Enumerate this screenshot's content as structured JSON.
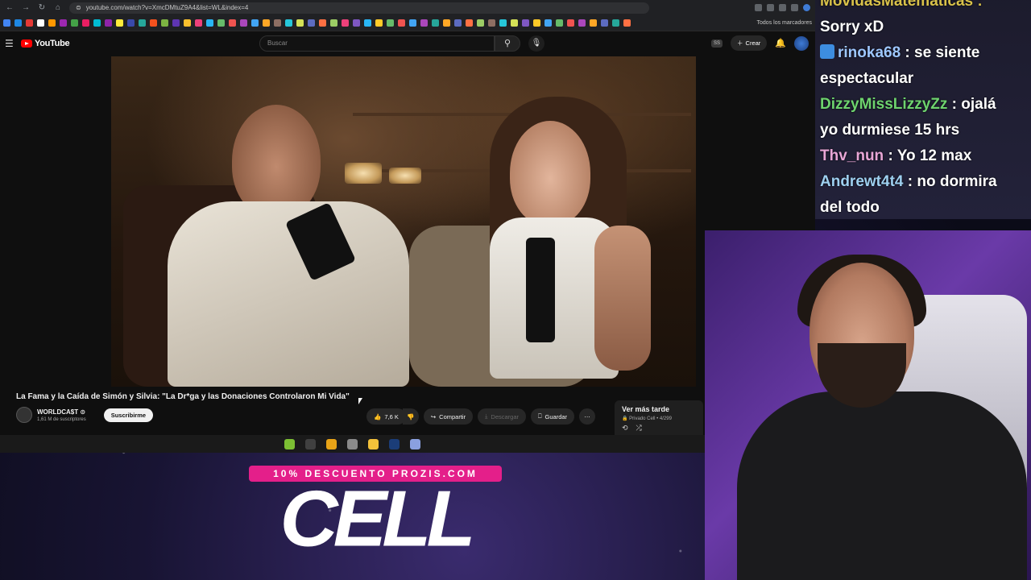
{
  "browser": {
    "url": "youtube.com/watch?v=XmcDMtuZ9A4&list=WL&index=4",
    "bookmarks_folder": "Todos los marcadores",
    "bookmark_colors": [
      "#4285f4",
      "#1e88e5",
      "#e53935",
      "#fff",
      "#ff9800",
      "#9c27b0",
      "#43a047",
      "#e91e63",
      "#00bcd4",
      "#8e24aa",
      "#ffeb3b",
      "#3949ab",
      "#26a69a",
      "#f4511e",
      "#7cb342",
      "#5e35b1",
      "#fbc02d",
      "#ec407a",
      "#29b6f6",
      "#66bb6a",
      "#ef5350",
      "#ab47bc",
      "#42a5f5",
      "#ffa726",
      "#8d6e63",
      "#26c6da",
      "#d4e157",
      "#5c6bc0",
      "#ff7043",
      "#9ccc65",
      "#ec407a",
      "#7e57c2",
      "#29b6f6",
      "#ffca28",
      "#66bb6a",
      "#ef5350",
      "#42a5f5",
      "#ab47bc",
      "#26a69a",
      "#ffa726",
      "#5c6bc0",
      "#ff7043",
      "#9ccc65",
      "#8d6e63",
      "#26c6da",
      "#d4e157",
      "#7e57c2",
      "#ffca28",
      "#42a5f5",
      "#66bb6a",
      "#ef5350",
      "#ab47bc",
      "#ffa726",
      "#5c6bc0",
      "#26a69a",
      "#ff7043"
    ]
  },
  "yt": {
    "logo": "YouTube",
    "search_placeholder": "Buscar",
    "ss_badge": "SS",
    "create_label": "Crear",
    "video_title": "La Fama y la Caída de Simón y Silvia: \"La Dr*ga y las Donaciones Controlaron Mi Vida\"",
    "channel_name": "WORLDCA$T ⊙",
    "channel_subs": "1,61 M de suscriptores",
    "subscribe_label": "Suscribirme",
    "likes": "7,6 K",
    "share_label": "Compartir",
    "download_label": "Descargar",
    "save_label": "Guardar",
    "playlist_title": "Ver más tarde",
    "playlist_meta": "🔒 Privado Cell • 4/299"
  },
  "taskbar": {
    "icons": [
      {
        "name": "xbox-icon",
        "color": "#7cbf33"
      },
      {
        "name": "obs-icon",
        "color": "#404040"
      },
      {
        "name": "chrome-icon",
        "color": "#e8a317"
      },
      {
        "name": "app-icon",
        "color": "#8a8a8a"
      },
      {
        "name": "folder-icon",
        "color": "#f3c13a"
      },
      {
        "name": "photoshop-icon",
        "color": "#1b3d78"
      },
      {
        "name": "discord-icon",
        "color": "#8aa0e0"
      }
    ]
  },
  "promo": {
    "banner": "10% DESCUENTO PROZIS.COM",
    "logo": "CELL"
  },
  "chat": {
    "messages": [
      {
        "user": "",
        "text": "MovidasMatematicas :",
        "color": "#d9c24a"
      },
      {
        "user": "",
        "text": "Sorry xD",
        "color": "#ffffff"
      },
      {
        "user": "rinoka68",
        "text": " : se siente",
        "color": "#9ec7ff",
        "badge": true
      },
      {
        "user": "",
        "text": "espectacular",
        "color": "#ffffff"
      },
      {
        "user": "DizzyMissLizzyZz",
        "text": " : ojalá",
        "color": "#6ed36e"
      },
      {
        "user": "",
        "text": "yo durmiese 15 hrs",
        "color": "#ffffff"
      },
      {
        "user": "Thv_nun",
        "text": " : Yo 12 max",
        "color": "#e8a6d6"
      },
      {
        "user": "Andrewt4t4",
        "text": " : no dormira",
        "color": "#9ed0f0"
      },
      {
        "user": "",
        "text": "del todo",
        "color": "#ffffff"
      }
    ]
  }
}
